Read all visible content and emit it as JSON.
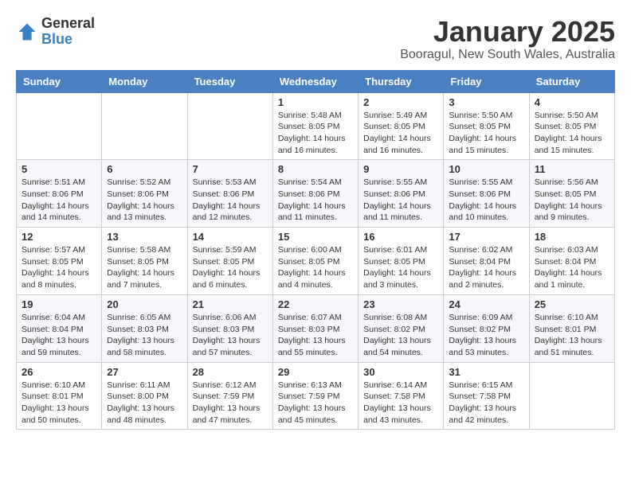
{
  "header": {
    "logo_general": "General",
    "logo_blue": "Blue",
    "month": "January 2025",
    "location": "Booragul, New South Wales, Australia"
  },
  "columns": [
    "Sunday",
    "Monday",
    "Tuesday",
    "Wednesday",
    "Thursday",
    "Friday",
    "Saturday"
  ],
  "weeks": [
    [
      {
        "day": "",
        "info": ""
      },
      {
        "day": "",
        "info": ""
      },
      {
        "day": "",
        "info": ""
      },
      {
        "day": "1",
        "info": "Sunrise: 5:48 AM\nSunset: 8:05 PM\nDaylight: 14 hours\nand 16 minutes."
      },
      {
        "day": "2",
        "info": "Sunrise: 5:49 AM\nSunset: 8:05 PM\nDaylight: 14 hours\nand 16 minutes."
      },
      {
        "day": "3",
        "info": "Sunrise: 5:50 AM\nSunset: 8:05 PM\nDaylight: 14 hours\nand 15 minutes."
      },
      {
        "day": "4",
        "info": "Sunrise: 5:50 AM\nSunset: 8:05 PM\nDaylight: 14 hours\nand 15 minutes."
      }
    ],
    [
      {
        "day": "5",
        "info": "Sunrise: 5:51 AM\nSunset: 8:06 PM\nDaylight: 14 hours\nand 14 minutes."
      },
      {
        "day": "6",
        "info": "Sunrise: 5:52 AM\nSunset: 8:06 PM\nDaylight: 14 hours\nand 13 minutes."
      },
      {
        "day": "7",
        "info": "Sunrise: 5:53 AM\nSunset: 8:06 PM\nDaylight: 14 hours\nand 12 minutes."
      },
      {
        "day": "8",
        "info": "Sunrise: 5:54 AM\nSunset: 8:06 PM\nDaylight: 14 hours\nand 11 minutes."
      },
      {
        "day": "9",
        "info": "Sunrise: 5:55 AM\nSunset: 8:06 PM\nDaylight: 14 hours\nand 11 minutes."
      },
      {
        "day": "10",
        "info": "Sunrise: 5:55 AM\nSunset: 8:06 PM\nDaylight: 14 hours\nand 10 minutes."
      },
      {
        "day": "11",
        "info": "Sunrise: 5:56 AM\nSunset: 8:05 PM\nDaylight: 14 hours\nand 9 minutes."
      }
    ],
    [
      {
        "day": "12",
        "info": "Sunrise: 5:57 AM\nSunset: 8:05 PM\nDaylight: 14 hours\nand 8 minutes."
      },
      {
        "day": "13",
        "info": "Sunrise: 5:58 AM\nSunset: 8:05 PM\nDaylight: 14 hours\nand 7 minutes."
      },
      {
        "day": "14",
        "info": "Sunrise: 5:59 AM\nSunset: 8:05 PM\nDaylight: 14 hours\nand 6 minutes."
      },
      {
        "day": "15",
        "info": "Sunrise: 6:00 AM\nSunset: 8:05 PM\nDaylight: 14 hours\nand 4 minutes."
      },
      {
        "day": "16",
        "info": "Sunrise: 6:01 AM\nSunset: 8:05 PM\nDaylight: 14 hours\nand 3 minutes."
      },
      {
        "day": "17",
        "info": "Sunrise: 6:02 AM\nSunset: 8:04 PM\nDaylight: 14 hours\nand 2 minutes."
      },
      {
        "day": "18",
        "info": "Sunrise: 6:03 AM\nSunset: 8:04 PM\nDaylight: 14 hours\nand 1 minute."
      }
    ],
    [
      {
        "day": "19",
        "info": "Sunrise: 6:04 AM\nSunset: 8:04 PM\nDaylight: 13 hours\nand 59 minutes."
      },
      {
        "day": "20",
        "info": "Sunrise: 6:05 AM\nSunset: 8:03 PM\nDaylight: 13 hours\nand 58 minutes."
      },
      {
        "day": "21",
        "info": "Sunrise: 6:06 AM\nSunset: 8:03 PM\nDaylight: 13 hours\nand 57 minutes."
      },
      {
        "day": "22",
        "info": "Sunrise: 6:07 AM\nSunset: 8:03 PM\nDaylight: 13 hours\nand 55 minutes."
      },
      {
        "day": "23",
        "info": "Sunrise: 6:08 AM\nSunset: 8:02 PM\nDaylight: 13 hours\nand 54 minutes."
      },
      {
        "day": "24",
        "info": "Sunrise: 6:09 AM\nSunset: 8:02 PM\nDaylight: 13 hours\nand 53 minutes."
      },
      {
        "day": "25",
        "info": "Sunrise: 6:10 AM\nSunset: 8:01 PM\nDaylight: 13 hours\nand 51 minutes."
      }
    ],
    [
      {
        "day": "26",
        "info": "Sunrise: 6:10 AM\nSunset: 8:01 PM\nDaylight: 13 hours\nand 50 minutes."
      },
      {
        "day": "27",
        "info": "Sunrise: 6:11 AM\nSunset: 8:00 PM\nDaylight: 13 hours\nand 48 minutes."
      },
      {
        "day": "28",
        "info": "Sunrise: 6:12 AM\nSunset: 7:59 PM\nDaylight: 13 hours\nand 47 minutes."
      },
      {
        "day": "29",
        "info": "Sunrise: 6:13 AM\nSunset: 7:59 PM\nDaylight: 13 hours\nand 45 minutes."
      },
      {
        "day": "30",
        "info": "Sunrise: 6:14 AM\nSunset: 7:58 PM\nDaylight: 13 hours\nand 43 minutes."
      },
      {
        "day": "31",
        "info": "Sunrise: 6:15 AM\nSunset: 7:58 PM\nDaylight: 13 hours\nand 42 minutes."
      },
      {
        "day": "",
        "info": ""
      }
    ]
  ]
}
